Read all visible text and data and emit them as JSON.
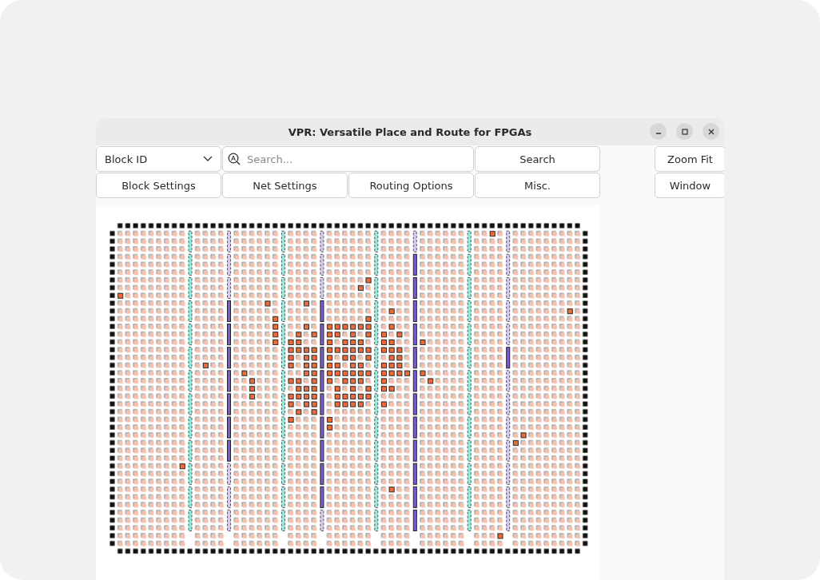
{
  "window": {
    "title": "VPR: Versatile Place and Route for FPGAs"
  },
  "toolbar": {
    "dropdown": {
      "value": "Block ID"
    },
    "search": {
      "placeholder": "Search..."
    },
    "row_1_buttons": [
      "Search"
    ],
    "row_2_buttons": [
      "Block Settings",
      "Net Settings",
      "Routing Options",
      "Misc."
    ],
    "side_buttons": [
      "Zoom Fit",
      "Window"
    ]
  }
}
